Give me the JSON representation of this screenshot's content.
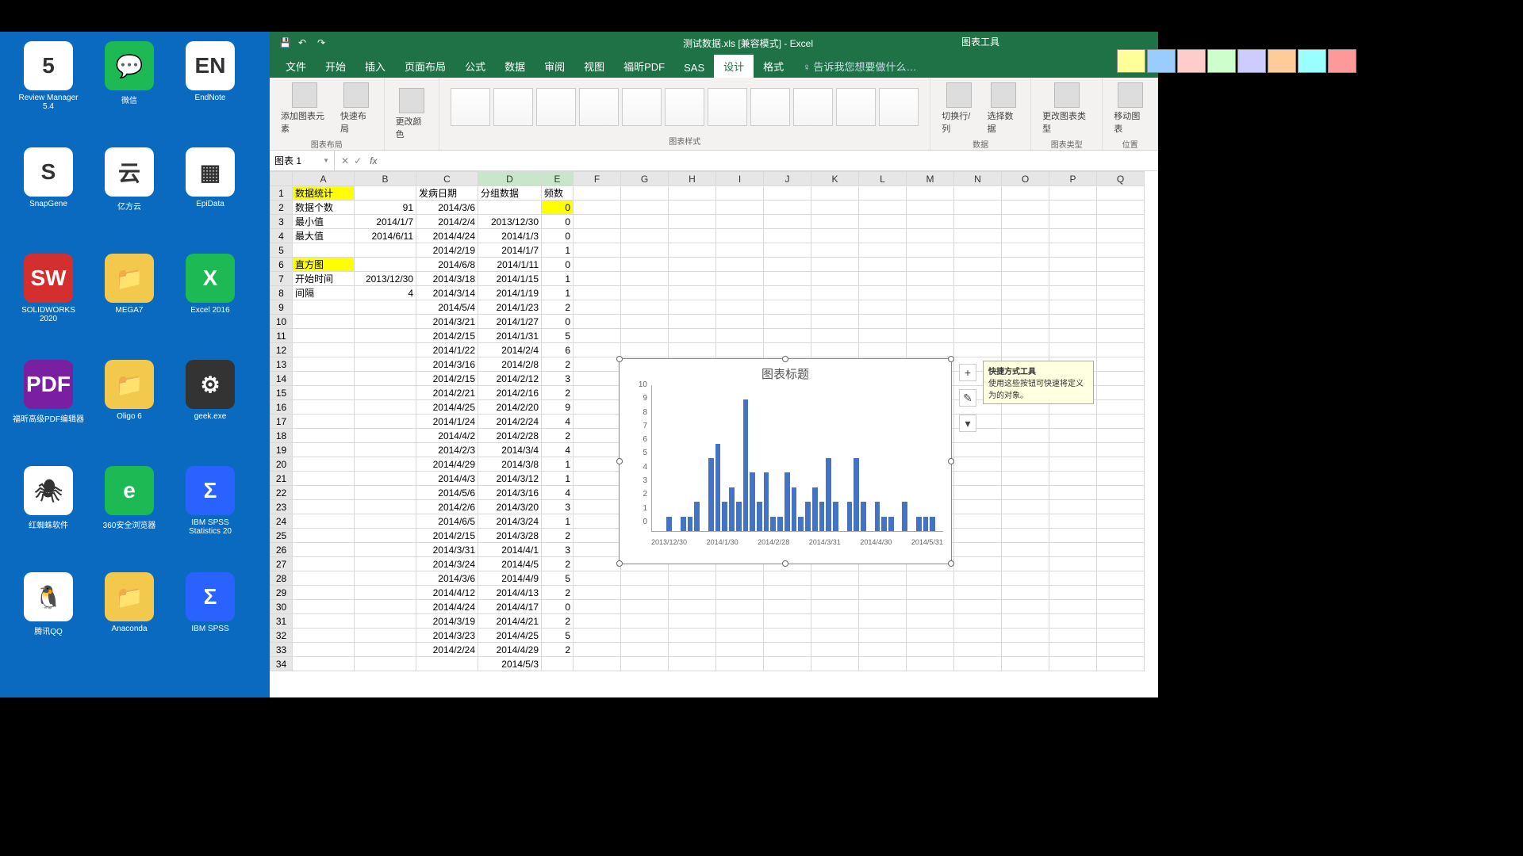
{
  "desktop_icons": [
    {
      "label": "Review Manager 5.4",
      "glyph": "5",
      "cls": ""
    },
    {
      "label": "微信",
      "glyph": "💬",
      "cls": "green"
    },
    {
      "label": "EndNote",
      "glyph": "EN",
      "cls": ""
    },
    {
      "label": "SnapGene",
      "glyph": "S",
      "cls": ""
    },
    {
      "label": "亿方云",
      "glyph": "云",
      "cls": ""
    },
    {
      "label": "EpiData",
      "glyph": "▦",
      "cls": ""
    },
    {
      "label": "SOLIDWORKS 2020",
      "glyph": "SW",
      "cls": "red"
    },
    {
      "label": "MEGA7",
      "glyph": "📁",
      "cls": "folder"
    },
    {
      "label": "Excel 2016",
      "glyph": "X",
      "cls": "green"
    },
    {
      "label": "福昕高级PDF编辑器",
      "glyph": "PDF",
      "cls": "purple"
    },
    {
      "label": "Oligo 6",
      "glyph": "📁",
      "cls": "folder"
    },
    {
      "label": "geek.exe",
      "glyph": "⚙",
      "cls": "dark"
    },
    {
      "label": "红蜘蛛软件",
      "glyph": "🕷",
      "cls": ""
    },
    {
      "label": "360安全浏览器",
      "glyph": "e",
      "cls": "green"
    },
    {
      "label": "IBM SPSS Statistics 20",
      "glyph": "Σ",
      "cls": "blue"
    },
    {
      "label": "腾讯QQ",
      "glyph": "🐧",
      "cls": ""
    },
    {
      "label": "Anaconda",
      "glyph": "📁",
      "cls": "folder"
    },
    {
      "label": "IBM SPSS",
      "glyph": "Σ",
      "cls": "blue"
    }
  ],
  "window": {
    "title": "测试数据.xls [兼容模式] - Excel",
    "chart_tools": "图表工具"
  },
  "menus": [
    "文件",
    "开始",
    "插入",
    "页面布局",
    "公式",
    "数据",
    "审阅",
    "视图",
    "福昕PDF",
    "SAS",
    "设计",
    "格式"
  ],
  "tell_me": "告诉我您想要做什么…",
  "ribbon": {
    "add_element": "添加图表元素",
    "quick_layout": "快速布局",
    "layout_group": "图表布局",
    "change_colors": "更改颜色",
    "styles_group": "图表样式",
    "switch": "切换行/列",
    "select_data": "选择数据",
    "data_group": "数据",
    "change_type": "更改图表类型",
    "type_group": "图表类型",
    "move_chart": "移动图表",
    "location_group": "位置"
  },
  "namebox": "图表 1",
  "columns": [
    "A",
    "B",
    "C",
    "D",
    "E",
    "F",
    "G",
    "H",
    "I",
    "J",
    "K",
    "L",
    "M",
    "N",
    "O",
    "P",
    "Q"
  ],
  "sheet": {
    "headers": {
      "A1": "数据统计",
      "C1": "发病日期",
      "D1": "分组数据",
      "E1": "频数"
    },
    "rows": [
      {
        "r": 2,
        "A": "数据个数",
        "B": "91",
        "C": "2014/3/6",
        "D": "",
        "E": "0"
      },
      {
        "r": 3,
        "A": "最小值",
        "B": "2014/1/7",
        "C": "2014/2/4",
        "D": "2013/12/30",
        "E": "0"
      },
      {
        "r": 4,
        "A": "最大值",
        "B": "2014/6/11",
        "C": "2014/4/24",
        "D": "2014/1/3",
        "E": "0"
      },
      {
        "r": 5,
        "A": "",
        "B": "",
        "C": "2014/2/19",
        "D": "2014/1/7",
        "E": "1"
      },
      {
        "r": 6,
        "A": "直方图",
        "B": "",
        "C": "2014/6/8",
        "D": "2014/1/11",
        "E": "0"
      },
      {
        "r": 7,
        "A": "开始时间",
        "B": "2013/12/30",
        "C": "2014/3/18",
        "D": "2014/1/15",
        "E": "1"
      },
      {
        "r": 8,
        "A": "间隔",
        "B": "4",
        "C": "2014/3/14",
        "D": "2014/1/19",
        "E": "1"
      },
      {
        "r": 9,
        "A": "",
        "B": "",
        "C": "2014/5/4",
        "D": "2014/1/23",
        "E": "2"
      },
      {
        "r": 10,
        "A": "",
        "B": "",
        "C": "2014/3/21",
        "D": "2014/1/27",
        "E": "0"
      },
      {
        "r": 11,
        "A": "",
        "B": "",
        "C": "2014/2/15",
        "D": "2014/1/31",
        "E": "5"
      },
      {
        "r": 12,
        "A": "",
        "B": "",
        "C": "2014/1/22",
        "D": "2014/2/4",
        "E": "6"
      },
      {
        "r": 13,
        "A": "",
        "B": "",
        "C": "2014/3/16",
        "D": "2014/2/8",
        "E": "2"
      },
      {
        "r": 14,
        "A": "",
        "B": "",
        "C": "2014/2/15",
        "D": "2014/2/12",
        "E": "3"
      },
      {
        "r": 15,
        "A": "",
        "B": "",
        "C": "2014/2/21",
        "D": "2014/2/16",
        "E": "2"
      },
      {
        "r": 16,
        "A": "",
        "B": "",
        "C": "2014/4/25",
        "D": "2014/2/20",
        "E": "9"
      },
      {
        "r": 17,
        "A": "",
        "B": "",
        "C": "2014/1/24",
        "D": "2014/2/24",
        "E": "4"
      },
      {
        "r": 18,
        "A": "",
        "B": "",
        "C": "2014/4/2",
        "D": "2014/2/28",
        "E": "2"
      },
      {
        "r": 19,
        "A": "",
        "B": "",
        "C": "2014/2/3",
        "D": "2014/3/4",
        "E": "4"
      },
      {
        "r": 20,
        "A": "",
        "B": "",
        "C": "2014/4/29",
        "D": "2014/3/8",
        "E": "1"
      },
      {
        "r": 21,
        "A": "",
        "B": "",
        "C": "2014/4/3",
        "D": "2014/3/12",
        "E": "1"
      },
      {
        "r": 22,
        "A": "",
        "B": "",
        "C": "2014/5/6",
        "D": "2014/3/16",
        "E": "4"
      },
      {
        "r": 23,
        "A": "",
        "B": "",
        "C": "2014/2/6",
        "D": "2014/3/20",
        "E": "3"
      },
      {
        "r": 24,
        "A": "",
        "B": "",
        "C": "2014/6/5",
        "D": "2014/3/24",
        "E": "1"
      },
      {
        "r": 25,
        "A": "",
        "B": "",
        "C": "2014/2/15",
        "D": "2014/3/28",
        "E": "2"
      },
      {
        "r": 26,
        "A": "",
        "B": "",
        "C": "2014/3/31",
        "D": "2014/4/1",
        "E": "3"
      },
      {
        "r": 27,
        "A": "",
        "B": "",
        "C": "2014/3/24",
        "D": "2014/4/5",
        "E": "2"
      },
      {
        "r": 28,
        "A": "",
        "B": "",
        "C": "2014/3/6",
        "D": "2014/4/9",
        "E": "5"
      },
      {
        "r": 29,
        "A": "",
        "B": "",
        "C": "2014/4/12",
        "D": "2014/4/13",
        "E": "2"
      },
      {
        "r": 30,
        "A": "",
        "B": "",
        "C": "2014/4/24",
        "D": "2014/4/17",
        "E": "0"
      },
      {
        "r": 31,
        "A": "",
        "B": "",
        "C": "2014/3/19",
        "D": "2014/4/21",
        "E": "2"
      },
      {
        "r": 32,
        "A": "",
        "B": "",
        "C": "2014/3/23",
        "D": "2014/4/25",
        "E": "5"
      },
      {
        "r": 33,
        "A": "",
        "B": "",
        "C": "2014/2/24",
        "D": "2014/4/29",
        "E": "2"
      },
      {
        "r": 34,
        "A": "",
        "B": "",
        "C": "",
        "D": "2014/5/3",
        "E": ""
      }
    ]
  },
  "tooltip": {
    "title": "快捷方式工具",
    "body": "使用这些按钮可快速将定义为的对象。"
  },
  "chart_data": {
    "type": "bar",
    "title": "图表标题",
    "ylabel": "",
    "xlabel": "",
    "ylim": [
      0,
      10
    ],
    "yticks": [
      0,
      1,
      2,
      3,
      4,
      5,
      6,
      7,
      8,
      9,
      10
    ],
    "x_tick_labels": [
      "2013/12/30",
      "2014/1/30",
      "2014/2/28",
      "2014/3/31",
      "2014/4/30",
      "2014/5/31"
    ],
    "categories": [
      "2013/12/30",
      "2014/1/3",
      "2014/1/7",
      "2014/1/11",
      "2014/1/15",
      "2014/1/19",
      "2014/1/23",
      "2014/1/27",
      "2014/1/31",
      "2014/2/4",
      "2014/2/8",
      "2014/2/12",
      "2014/2/16",
      "2014/2/20",
      "2014/2/24",
      "2014/2/28",
      "2014/3/4",
      "2014/3/8",
      "2014/3/12",
      "2014/3/16",
      "2014/3/20",
      "2014/3/24",
      "2014/3/28",
      "2014/4/1",
      "2014/4/5",
      "2014/4/9",
      "2014/4/13",
      "2014/4/17",
      "2014/4/21",
      "2014/4/25",
      "2014/4/29",
      "2014/5/3",
      "2014/5/7",
      "2014/5/11",
      "2014/5/15",
      "2014/5/19",
      "2014/5/23",
      "2014/5/27",
      "2014/5/31",
      "2014/6/4",
      "2014/6/8",
      "2014/6/12"
    ],
    "values": [
      0,
      0,
      1,
      0,
      1,
      1,
      2,
      0,
      5,
      6,
      2,
      3,
      2,
      9,
      4,
      2,
      4,
      1,
      1,
      4,
      3,
      1,
      2,
      3,
      2,
      5,
      2,
      0,
      2,
      5,
      2,
      0,
      2,
      1,
      1,
      0,
      2,
      0,
      1,
      1,
      1,
      0
    ]
  }
}
